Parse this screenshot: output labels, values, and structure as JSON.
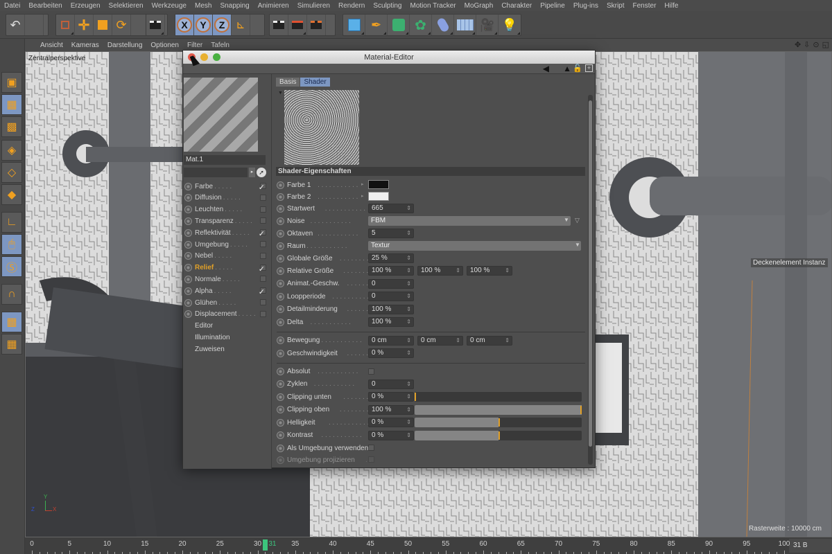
{
  "menubar": [
    "Datei",
    "Bearbeiten",
    "Erzeugen",
    "Selektieren",
    "Werkzeuge",
    "Mesh",
    "Snapping",
    "Animieren",
    "Simulieren",
    "Rendern",
    "Sculpting",
    "Motion Tracker",
    "MoGraph",
    "Charakter",
    "Pipeline",
    "Plug-ins",
    "Skript",
    "Fenster",
    "Hilfe"
  ],
  "toolbar": {
    "undo_icon": "undo-icon",
    "axis_labels": [
      "X",
      "Y",
      "Z"
    ]
  },
  "left_toolbar_icons": [
    "model-mode-icon",
    "texture-mode-icon",
    "workplane-mode-icon",
    "points-mode-icon",
    "edges-mode-icon",
    "polygons-mode-icon",
    "axis-mode-icon",
    "tweak-mode-icon",
    "solo-mode-icon",
    "snap-magnet-icon",
    "workplane-lock-icon",
    "workplane-rotate-icon"
  ],
  "viewport": {
    "menu": [
      "Ansicht",
      "Kameras",
      "Darstellung",
      "Optionen",
      "Filter",
      "Tafeln"
    ],
    "camera_label": "Zentralperspektive",
    "tooltip": "Deckenelement Instanz",
    "grid_info": "Rasterweite : 10000 cm",
    "axis": {
      "x": "X",
      "y": "Y",
      "z": "Z"
    }
  },
  "timeline": {
    "ticks": [
      "0",
      "5",
      "10",
      "15",
      "20",
      "25",
      "30",
      "35",
      "40",
      "45",
      "50",
      "55",
      "60",
      "65",
      "70",
      "75",
      "80",
      "85",
      "90",
      "95",
      "100"
    ],
    "current_frame": "31",
    "frame_field": "31 B",
    "current_fraction": 0.31
  },
  "editor": {
    "title": "Material-Editor",
    "material_name": "Mat.1",
    "channels": [
      {
        "label": "Farbe",
        "checked": true,
        "active": false
      },
      {
        "label": "Diffusion",
        "checked": false,
        "active": false
      },
      {
        "label": "Leuchten",
        "checked": false,
        "active": false
      },
      {
        "label": "Transparenz",
        "checked": false,
        "active": false
      },
      {
        "label": "Reflektivität",
        "checked": true,
        "active": false
      },
      {
        "label": "Umgebung",
        "checked": false,
        "active": false
      },
      {
        "label": "Nebel",
        "checked": false,
        "active": false
      },
      {
        "label": "Relief",
        "checked": true,
        "active": true
      },
      {
        "label": "Normale",
        "checked": false,
        "active": false
      },
      {
        "label": "Alpha",
        "checked": true,
        "active": false
      },
      {
        "label": "Glühen",
        "checked": false,
        "active": false
      },
      {
        "label": "Displacement",
        "checked": false,
        "active": false
      }
    ],
    "extra_items": [
      "Editor",
      "Illumination",
      "Zuweisen"
    ],
    "tabs": [
      {
        "label": "Basis",
        "active": false
      },
      {
        "label": "Shader",
        "active": true
      }
    ],
    "section_title": "Shader-Eigenschaften",
    "props": {
      "farbe1": {
        "label": "Farbe 1",
        "color": "#111111"
      },
      "farbe2": {
        "label": "Farbe 2",
        "color": "#eeeeee"
      },
      "startwert": {
        "label": "Startwert",
        "value": "665"
      },
      "noise": {
        "label": "Noise",
        "value": "FBM"
      },
      "oktaven": {
        "label": "Oktaven",
        "value": "5"
      },
      "raum": {
        "label": "Raum",
        "value": "Textur"
      },
      "globale_groesse": {
        "label": "Globale Größe",
        "value": "25 %"
      },
      "relative_groesse": {
        "label": "Relative Größe",
        "values": [
          "100 %",
          "100 %",
          "100 %"
        ]
      },
      "animat": {
        "label": "Animat.-Geschw.",
        "value": "0"
      },
      "loopperiode": {
        "label": "Loopperiode",
        "value": "0"
      },
      "detailminderung": {
        "label": "Detailminderung",
        "value": "100 %"
      },
      "delta": {
        "label": "Delta",
        "value": "100 %"
      },
      "bewegung": {
        "label": "Bewegung",
        "values": [
          "0 cm",
          "0 cm",
          "0 cm"
        ]
      },
      "geschwindigkeit": {
        "label": "Geschwindigkeit",
        "value": "0 %"
      },
      "absolut": {
        "label": "Absolut",
        "checked": false
      },
      "zyklen": {
        "label": "Zyklen",
        "value": "0"
      },
      "clipping_unten": {
        "label": "Clipping unten",
        "value": "0 %",
        "fraction": 0.0
      },
      "clipping_oben": {
        "label": "Clipping oben",
        "value": "100 %",
        "fraction": 1.0
      },
      "helligkeit": {
        "label": "Helligkeit",
        "value": "0 %",
        "fraction": 0.5
      },
      "kontrast": {
        "label": "Kontrast",
        "value": "0 %",
        "fraction": 0.5
      },
      "als_umgebung": {
        "label": "Als Umgebung verwenden",
        "checked": false
      },
      "umgebung_proj": {
        "label": "Umgebung projizieren",
        "checked": false
      }
    }
  },
  "colors": {
    "accent_blue": "#7d97c2",
    "slider_knob": "#e0a028",
    "active_channel": "#e0a028",
    "frame_marker": "#3cc47c"
  }
}
